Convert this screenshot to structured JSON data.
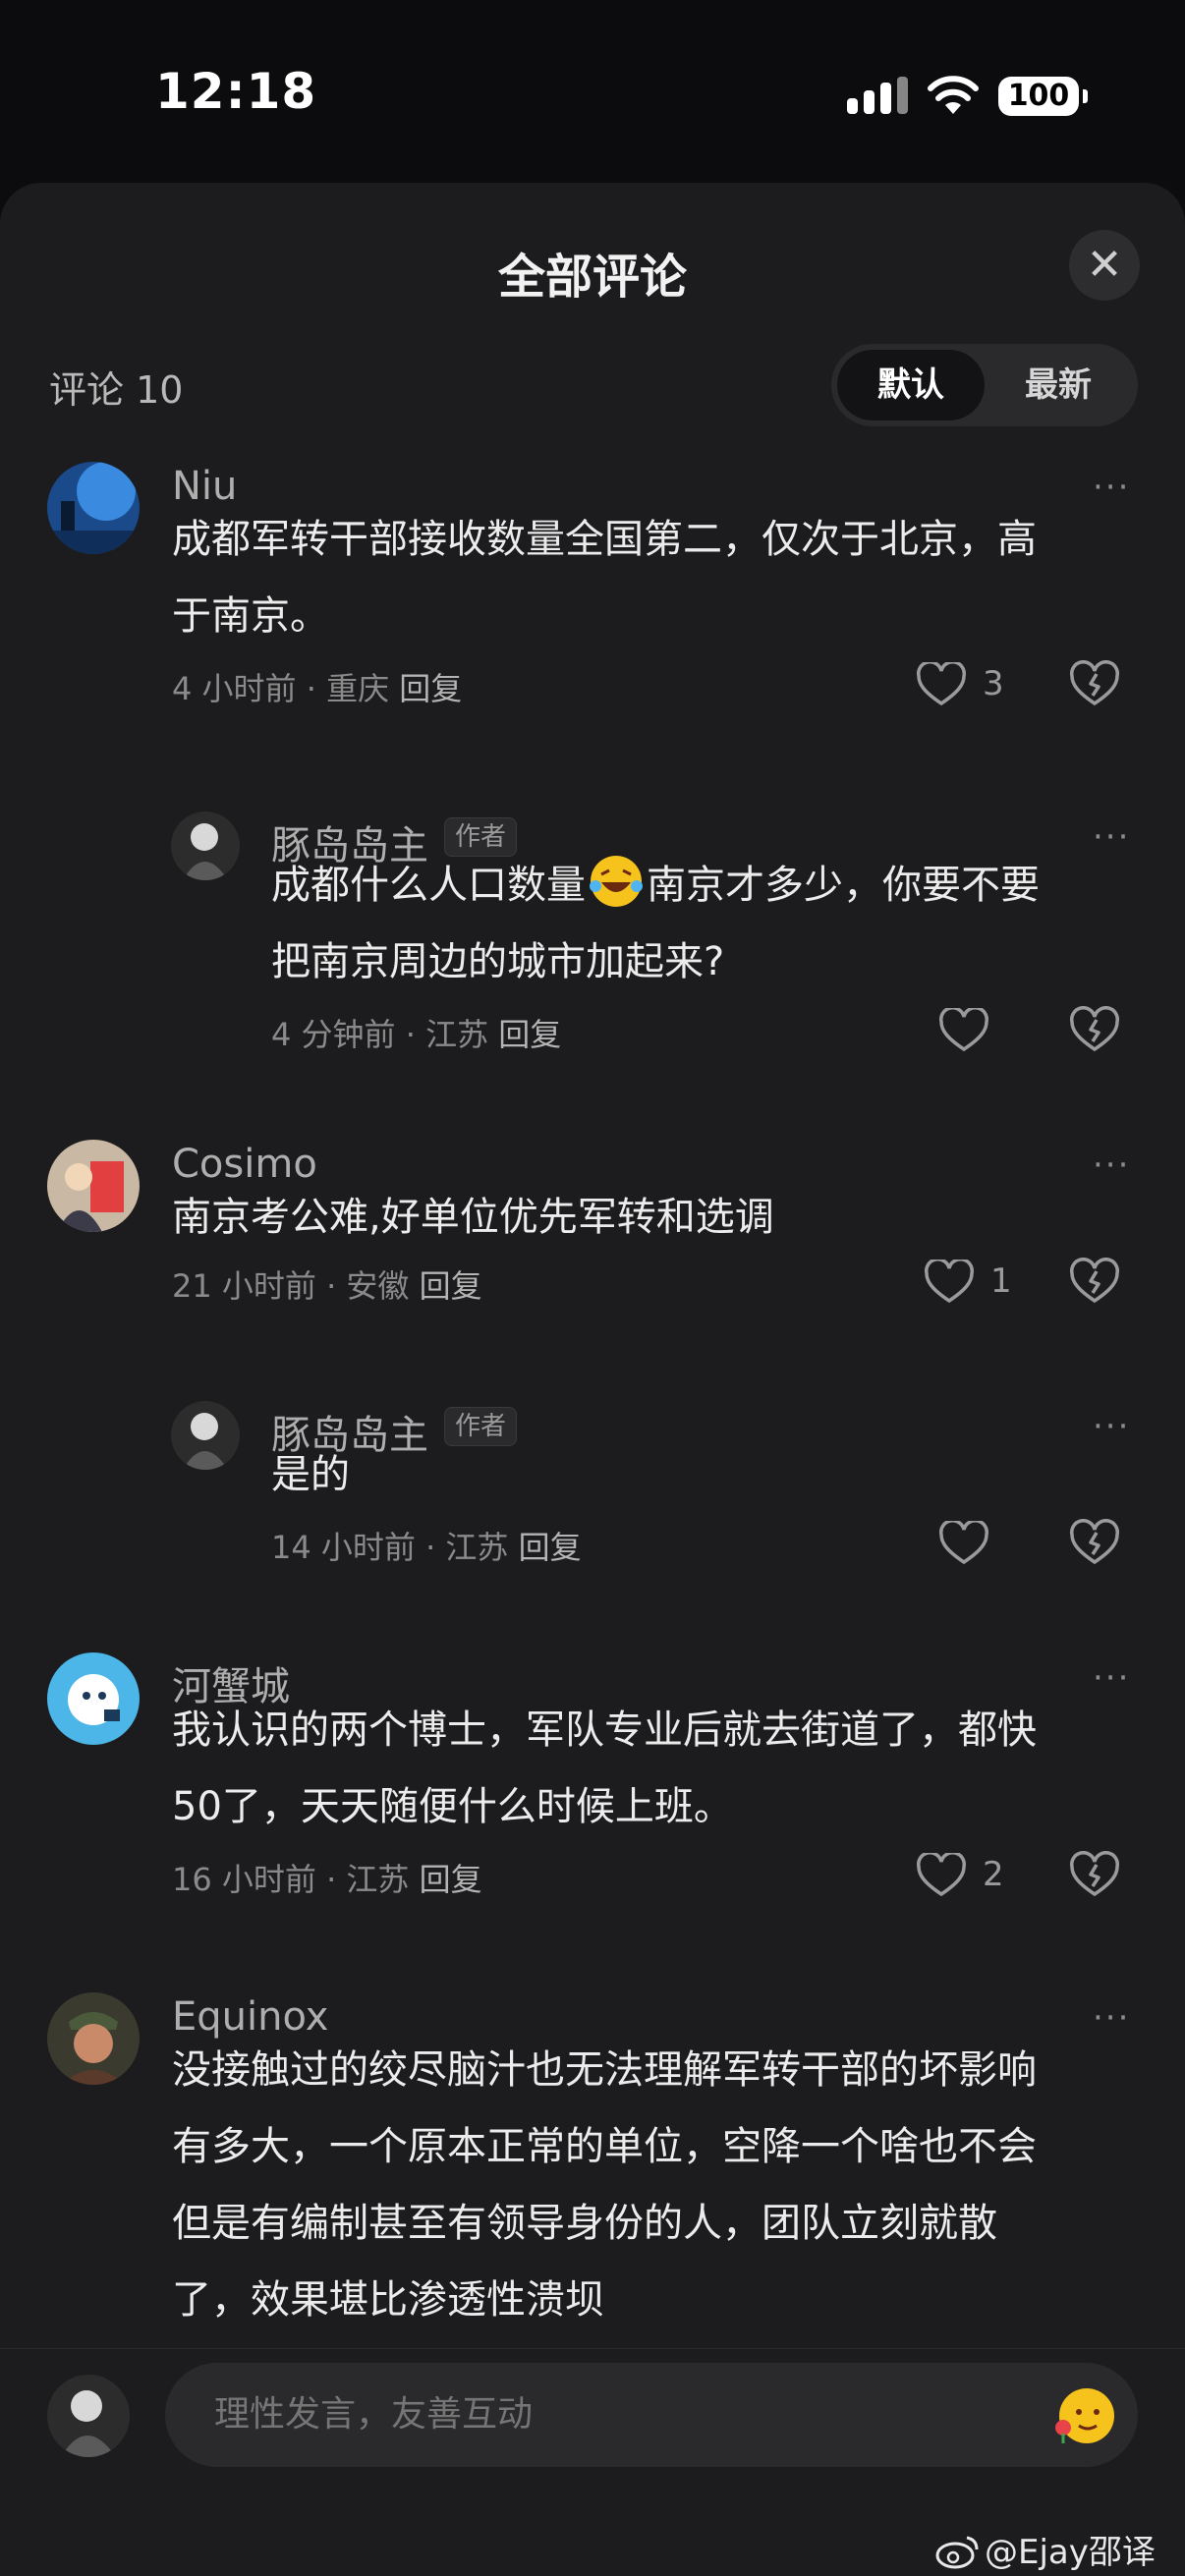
{
  "status_bar": {
    "time": "12:18",
    "battery": "100"
  },
  "header": {
    "title": "全部评论",
    "close_icon": "close-icon"
  },
  "toolbar": {
    "count_label": "评论 10",
    "sort_default": "默认",
    "sort_latest": "最新",
    "active_sort": "默认"
  },
  "comments": [
    {
      "name": "Niu",
      "text_line1": "成都军转干部接收数量全国第二，仅次于北京，高",
      "text_line2": "于南京。",
      "time": "4 小时前",
      "location": "重庆",
      "reply": "回复",
      "likes": "3"
    },
    {
      "name": "豚岛岛主",
      "author_tag": "作者",
      "text_a": "成都什么人口数量",
      "text_b": "南京才多少，你要不要",
      "text_line2": "把南京周边的城市加起来?",
      "time": "4 分钟前",
      "location": "江苏",
      "reply": "回复",
      "likes": ""
    },
    {
      "name": "Cosimo",
      "text_line1": "南京考公难,好单位优先军转和选调",
      "time": "21 小时前",
      "location": "安徽",
      "reply": "回复",
      "likes": "1"
    },
    {
      "name": "豚岛岛主",
      "author_tag": "作者",
      "text_line1": "是的",
      "time": "14 小时前",
      "location": "江苏",
      "reply": "回复",
      "likes": ""
    },
    {
      "name": "河蟹城",
      "text_line1": "我认识的两个博士，军队专业后就去街道了，都快",
      "text_line2": "50了，天天随便什么时候上班。",
      "time": "16 小时前",
      "location": "江苏",
      "reply": "回复",
      "likes": "2"
    },
    {
      "name": "Equinox",
      "text_line1": "没接触过的绞尽脑汁也无法理解军转干部的坏影响",
      "text_line2": "有多大，一个原本正常的单位，空降一个啥也不会",
      "text_line3": "但是有编制甚至有领导身份的人，团队立刻就散",
      "text_line4": "了，效果堪比渗透性溃坝"
    }
  ],
  "input": {
    "placeholder": "理性发言，友善互动"
  },
  "watermark": "@Ejay邵译瑾",
  "colors": {
    "background": "#0c0c0e",
    "sheet": "#1c1c1e",
    "text": "#ececec",
    "muted": "#8a8a8a"
  }
}
